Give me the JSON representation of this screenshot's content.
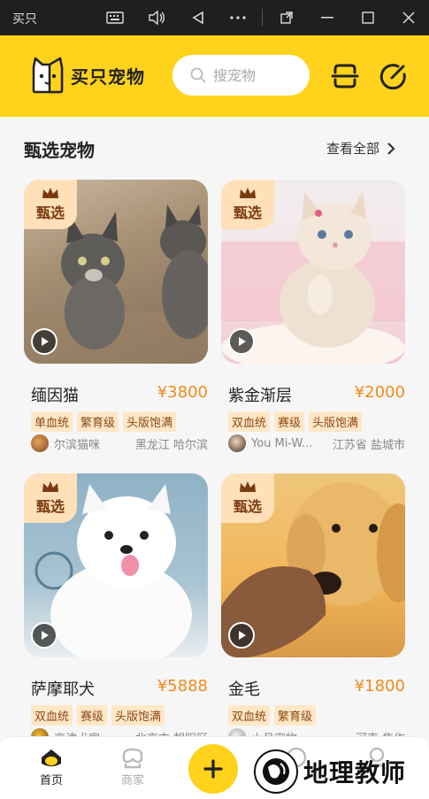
{
  "window": {
    "title": "买只"
  },
  "header": {
    "logo_text": "买只宠物",
    "search_placeholder": "搜宠物"
  },
  "section": {
    "title": "甄选宠物",
    "see_all": "查看全部"
  },
  "badge_label": "甄选",
  "pets": [
    {
      "name": "缅因猫",
      "price": "¥3800",
      "tags": [
        "单血统",
        "繁育级",
        "头版饱满"
      ],
      "seller": "尔滨猫咪",
      "location": "黑龙江 哈尔滨"
    },
    {
      "name": "紫金渐层",
      "price": "¥2000",
      "tags": [
        "双血统",
        "赛级",
        "头版饱满"
      ],
      "seller": "You Mi-W...",
      "location": "江苏省 盐城市"
    },
    {
      "name": "萨摩耶犬",
      "price": "¥5888",
      "tags": [
        "双血统",
        "赛级",
        "头版饱满"
      ],
      "seller": "京津犬家",
      "location": "北京市 朝阳区"
    },
    {
      "name": "金毛",
      "price": "¥1800",
      "tags": [
        "双血统",
        "繁育级"
      ],
      "seller": "小月宠物",
      "location": "河南 焦作"
    }
  ],
  "nav": {
    "home": "首页",
    "merchant": "商家"
  },
  "watermark": "地理教师",
  "colors": {
    "brand_yellow": "#ffd21c",
    "price_orange": "#f08a1a",
    "tag_bg": "#ffe7c8"
  }
}
